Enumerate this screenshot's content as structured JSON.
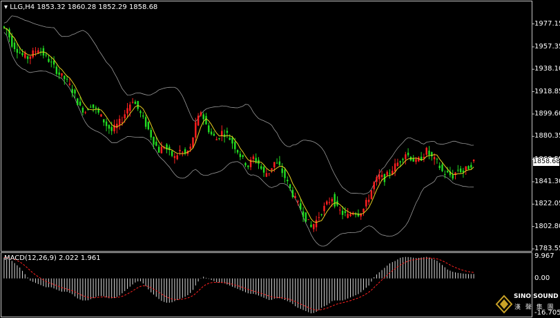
{
  "chart": {
    "title": "LLG,H4  1853.32 1860.28 1852.29 1858.68",
    "current_price": "1858.68",
    "price_axis": [
      "1977.15",
      "1957.35",
      "1938.10",
      "1918.85",
      "1899.60",
      "1880.35",
      "1860.55",
      "1841.30",
      "1822.05",
      "1802.80",
      "1783.55"
    ],
    "colors": {
      "background": "#000000",
      "bull_candle": "#ff2020",
      "bear_candle": "#22dd22",
      "ma_line": "#e8d020",
      "bollinger": "#9a9a9a",
      "macd_hist": "#d8d8d8",
      "macd_signal": "#ff2020"
    }
  },
  "macd": {
    "title": "MACD(12,26,9) 2.022 1.961",
    "axis": [
      "9.967",
      "0.00",
      "-16.705"
    ]
  },
  "watermark": {
    "brand": "SINO SOUND",
    "chinese": "漢 聲 集 團"
  },
  "chart_data": {
    "type": "candlestick",
    "title": "LLG,H4  1853.32 1860.28 1852.29 1858.68",
    "ylim": [
      1783.55,
      1987
    ],
    "close_path": [
      1975,
      1972,
      1960,
      1955,
      1950,
      1948,
      1952,
      1956,
      1951,
      1946,
      1940,
      1934,
      1930,
      1924,
      1915,
      1905,
      1902,
      1908,
      1903,
      1897,
      1890,
      1885,
      1890,
      1895,
      1905,
      1912,
      1904,
      1895,
      1886,
      1876,
      1868,
      1872,
      1866,
      1862,
      1868,
      1865,
      1870,
      1890,
      1902,
      1890,
      1882,
      1878,
      1884,
      1882,
      1875,
      1868,
      1860,
      1855,
      1862,
      1857,
      1848,
      1850,
      1858,
      1854,
      1845,
      1835,
      1826,
      1818,
      1810,
      1802,
      1808,
      1816,
      1822,
      1828,
      1818,
      1814,
      1812,
      1816,
      1814,
      1818,
      1828,
      1840,
      1846,
      1844,
      1850,
      1855,
      1860,
      1866,
      1862,
      1858,
      1862,
      1868,
      1862,
      1858,
      1850,
      1848,
      1846,
      1852,
      1850,
      1854,
      1858.68
    ],
    "macd_hist_path": [
      9.5,
      9,
      7,
      5,
      2,
      -1,
      -2,
      -3,
      -4,
      -4,
      -5,
      -6,
      -6,
      -7,
      -9,
      -10,
      -10,
      -9,
      -8,
      -8,
      -9,
      -9,
      -8,
      -6,
      -4,
      -2,
      -1,
      -3,
      -6,
      -8,
      -10,
      -11,
      -11,
      -10,
      -9,
      -8,
      -6,
      -2,
      1,
      0,
      -1,
      -2,
      -2,
      -3,
      -4,
      -5,
      -6,
      -7,
      -7,
      -8,
      -9,
      -10,
      -9,
      -9,
      -10,
      -11,
      -13,
      -14,
      -15,
      -16,
      -15,
      -13,
      -12,
      -10,
      -10,
      -10,
      -9,
      -8,
      -7,
      -5,
      -3,
      1,
      3,
      5,
      7,
      8,
      9.5,
      9.8,
      9.6,
      9.2,
      9.5,
      9.8,
      9,
      8,
      6,
      4,
      3,
      2.5,
      2.2,
      2,
      2.02
    ],
    "series": [
      {
        "name": "MACD(12,26,9)",
        "values_ref": "macd_hist_path"
      }
    ]
  }
}
